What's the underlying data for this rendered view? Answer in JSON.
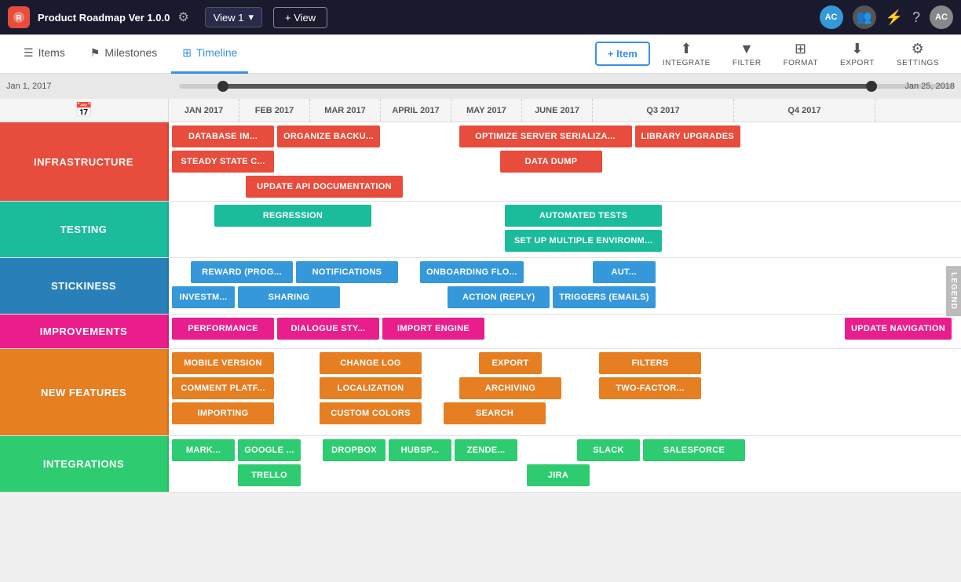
{
  "app": {
    "logo": "R",
    "title": "Product Roadmap Ver 1.0.0",
    "view": "View 1",
    "add_view": "+ View"
  },
  "nav": {
    "items_label": "Items",
    "milestones_label": "Milestones",
    "timeline_label": "Timeline",
    "add_item_label": "+ Item",
    "integrate_label": "INTEGRATE",
    "filter_label": "FILTER",
    "format_label": "FORMAT",
    "export_label": "EXPORT",
    "settings_label": "SETTINGS"
  },
  "timeline": {
    "range_start": "Jan 1, 2017",
    "range_end": "Jan 25, 2018",
    "months": [
      "JAN 2017",
      "FEB 2017",
      "MAR 2017",
      "APRIL 2017",
      "MAY 2017",
      "JUNE 2017",
      "Q3 2017",
      "Q4 2017"
    ]
  },
  "rows": [
    {
      "label": "INFRASTRUCTURE",
      "color": "red",
      "chips": [
        [
          {
            "text": "DATABASE IM...",
            "color": "red",
            "size": "sm"
          },
          {
            "text": "ORGANIZE BACKU...",
            "color": "red",
            "size": "md"
          },
          {
            "spacer": true
          },
          {
            "text": "OPTIMIZE SERVER SERIALIZA...",
            "color": "red",
            "size": "lg"
          },
          {
            "text": "LIBRARY UPGRADES",
            "color": "red",
            "size": "md"
          }
        ],
        [
          {
            "text": "STEADY STATE C...",
            "color": "red",
            "size": "sm"
          },
          {
            "spacer": true
          },
          {
            "text": "DATA DUMP",
            "color": "red",
            "size": "md"
          }
        ],
        [
          {
            "spacer2": true
          },
          {
            "text": "UPDATE API DOCUMENTATION",
            "color": "red",
            "size": "lg"
          }
        ]
      ]
    },
    {
      "label": "TESTING",
      "color": "teal",
      "chips": [
        [
          {
            "spacer3": true
          },
          {
            "text": "REGRESSION",
            "color": "teal",
            "size": "lg"
          },
          {
            "spacer": true
          },
          {
            "text": "AUTOMATED TESTS",
            "color": "teal",
            "size": "lg"
          }
        ],
        [
          {
            "spacer": true
          },
          {
            "text": "SET UP MULTIPLE ENVIRONM...",
            "color": "teal",
            "size": "lg"
          }
        ]
      ]
    },
    {
      "label": "STICKINESS",
      "color": "blue",
      "chips": [
        [
          {
            "spacer4": true
          },
          {
            "text": "REWARD (PROG...",
            "color": "blue",
            "size": "md"
          },
          {
            "text": "NOTIFICATIONS",
            "color": "blue",
            "size": "md"
          },
          {
            "spacer": true
          },
          {
            "text": "ONBOARDING FLO...",
            "color": "blue",
            "size": "md"
          },
          {
            "spacer5": true
          },
          {
            "text": "AUT...",
            "color": "blue",
            "size": "sm"
          }
        ],
        [
          {
            "text": "INVESTM...",
            "color": "blue",
            "size": "sm"
          },
          {
            "text": "SHARING",
            "color": "blue",
            "size": "md"
          },
          {
            "spacer": true
          },
          {
            "text": "ACTION (REPLY)",
            "color": "blue",
            "size": "md"
          },
          {
            "text": "TRIGGERS (EMAILS)",
            "color": "blue",
            "size": "md"
          }
        ]
      ]
    },
    {
      "label": "IMPROVEMENTS",
      "color": "pink",
      "chips": [
        [
          {
            "text": "PERFORMANCE",
            "color": "pink",
            "size": "md"
          },
          {
            "text": "DIALOGUE STY...",
            "color": "pink",
            "size": "md"
          },
          {
            "text": "IMPORT ENGINE",
            "color": "pink",
            "size": "md"
          },
          {
            "spacer": true
          },
          {
            "text": "UPDATE NAVIGATION",
            "color": "pink",
            "size": "md"
          }
        ]
      ]
    },
    {
      "label": "NEW FEATURES",
      "color": "orange",
      "chips": [
        [
          {
            "text": "MOBILE VERSION",
            "color": "orange",
            "size": "md"
          },
          {
            "spacer6": true
          },
          {
            "text": "CHANGE LOG",
            "color": "orange",
            "size": "md"
          },
          {
            "spacer": true
          },
          {
            "text": "EXPORT",
            "color": "orange",
            "size": "md"
          },
          {
            "spacer": true
          },
          {
            "text": "FILTERS",
            "color": "orange",
            "size": "md"
          }
        ],
        [
          {
            "text": "COMMENT PLATF...",
            "color": "orange",
            "size": "md"
          },
          {
            "spacer6": true
          },
          {
            "text": "LOCALIZATION",
            "color": "orange",
            "size": "md"
          },
          {
            "spacer": true
          },
          {
            "text": "ARCHIVING",
            "color": "orange",
            "size": "md"
          },
          {
            "spacer": true
          },
          {
            "text": "TWO-FACTOR...",
            "color": "orange",
            "size": "md"
          }
        ],
        [
          {
            "text": "IMPORTING",
            "color": "orange",
            "size": "md"
          },
          {
            "spacer6": true
          },
          {
            "text": "CUSTOM COLORS",
            "color": "orange",
            "size": "md"
          },
          {
            "spacer": true
          },
          {
            "text": "SEARCH",
            "color": "orange",
            "size": "md"
          }
        ]
      ]
    },
    {
      "label": "INTEGRATIONS",
      "color": "dark-green",
      "chips": [
        [
          {
            "text": "MARK...",
            "color": "dark-green",
            "size": "sm"
          },
          {
            "text": "GOOGLE ...",
            "color": "dark-green",
            "size": "sm"
          },
          {
            "spacer7": true
          },
          {
            "text": "DROPBOX",
            "color": "dark-green",
            "size": "sm"
          },
          {
            "text": "HUBSP...",
            "color": "dark-green",
            "size": "sm"
          },
          {
            "text": "ZENDE...",
            "color": "dark-green",
            "size": "sm"
          },
          {
            "spacer": true
          },
          {
            "text": "SLACK",
            "color": "dark-green",
            "size": "sm"
          },
          {
            "text": "SALESFORCE",
            "color": "dark-green",
            "size": "md"
          }
        ],
        [
          {
            "spacer8": true
          },
          {
            "text": "TRELLO",
            "color": "dark-green",
            "size": "sm"
          },
          {
            "spacer9": true
          },
          {
            "text": "JIRA",
            "color": "dark-green",
            "size": "sm"
          }
        ]
      ]
    }
  ],
  "legend": "LEGEND"
}
